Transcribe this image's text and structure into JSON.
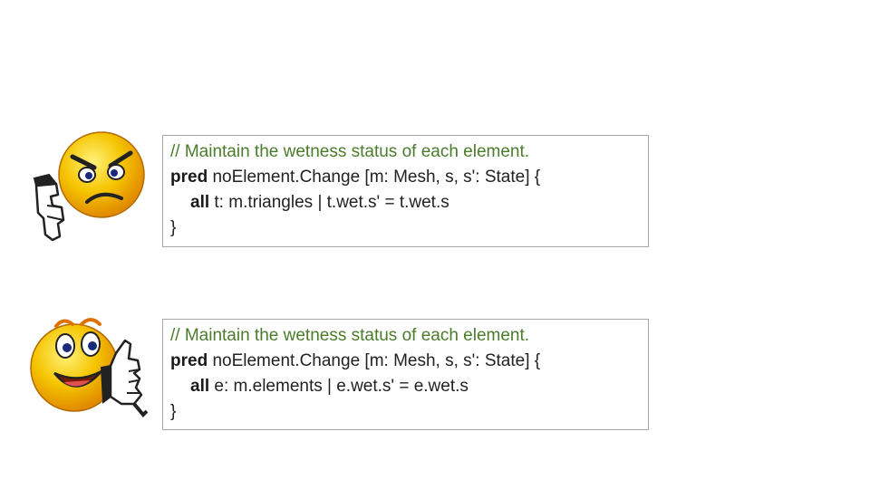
{
  "snippets": [
    {
      "verdict_icon": "thumbs-down-frowning-smiley-icon",
      "comment": "// Maintain the wetness status of each element.",
      "keyword_pred": "pred",
      "signature": " noElement.Change [m: Mesh, s, s': State] {",
      "keyword_all": "all",
      "body": " t: m.triangles | t.wet.s' = t.wet.s",
      "close": "}"
    },
    {
      "verdict_icon": "thumbs-up-smiling-smiley-icon",
      "comment": "// Maintain the wetness status of each element.",
      "keyword_pred": "pred",
      "signature": " noElement.Change [m: Mesh, s, s': State] {",
      "keyword_all": "all",
      "body": " e: m.elements | e.wet.s' = e.wet.s",
      "close": "}"
    }
  ],
  "colors": {
    "comment": "#4a7c2a",
    "border": "#a6a6a6",
    "smiley_fill": "#f5c400"
  }
}
